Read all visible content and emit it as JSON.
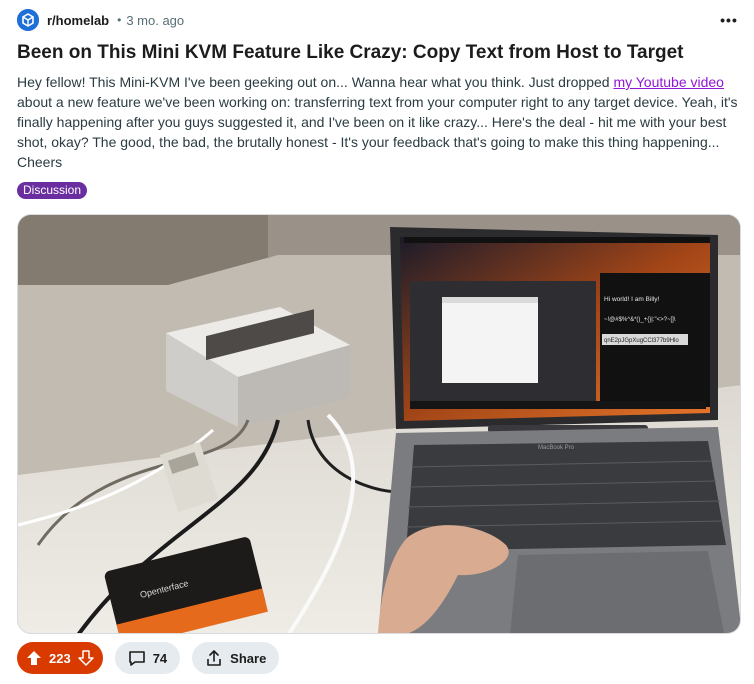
{
  "post": {
    "subreddit": "r/homelab",
    "separator": "•",
    "age": "3 mo. ago",
    "more_label": "•••",
    "title": "Been on This Mini KVM Feature Like Crazy: Copy Text from Host to Target",
    "body_before_link": "Hey fellow! This Mini-KVM I've been geeking out on... Wanna hear what you think. Just dropped ",
    "link_text": "my Youtube video",
    "body_after_link": " about a new feature we've been working on: transferring text from your computer right to any target device. Yeah, it's finally happening after you guys suggested it, and I've been on it like crazy... Here's the deal - hit me with your best shot, okay? The good, the bad, the brutally honest - It's your feedback that's going to make this thing happening... Cheers",
    "flair": "Discussion"
  },
  "media": {
    "screen_lines": [
      "Hi world! I am Billy!",
      "~!@#$%^&*()_+{}|:\"<>?~[]\\",
      "qnE2pJGpXugCCl377b9Hlo"
    ],
    "laptop_label": "MacBook Pro"
  },
  "actions": {
    "votes": "223",
    "comments": "74",
    "share": "Share"
  },
  "colors": {
    "vote_bg": "#d93a00",
    "flair_bg": "#6a2ea0",
    "link": "#9116d6",
    "pill_bg": "#e5ebee"
  },
  "icons": [
    "subreddit-icon",
    "more-icon",
    "upvote-icon",
    "downvote-icon",
    "comment-icon",
    "share-icon"
  ]
}
